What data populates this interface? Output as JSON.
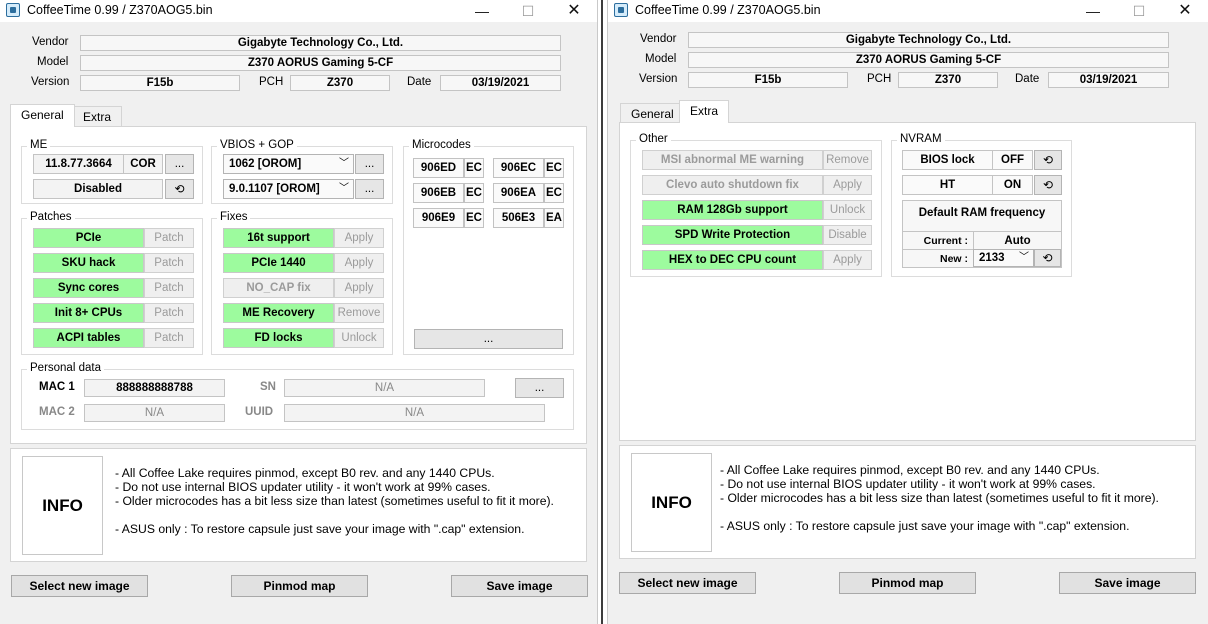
{
  "left": {
    "title": "CoffeeTime 0.99  /  Z370AOG5.bin",
    "vendor_label": "Vendor",
    "vendor": "Gigabyte Technology Co., Ltd.",
    "model_label": "Model",
    "model": "Z370 AORUS Gaming 5-CF",
    "version_label": "Version",
    "version": "F15b",
    "pch_label": "PCH",
    "pch": "Z370",
    "date_label": "Date",
    "date": "03/19/2021",
    "tabs": [
      "General",
      "Extra"
    ],
    "me": {
      "title": "ME",
      "version": "11.8.77.3664",
      "type": "COR",
      "more": "...",
      "status": "Disabled",
      "refresh_icon": "refresh-icon"
    },
    "vbios": {
      "title": "VBIOS + GOP",
      "vbios_value": "1062 [OROM]",
      "gop_value": "9.0.1107 [OROM]",
      "more": "..."
    },
    "microcodes": {
      "title": "Microcodes",
      "items": [
        {
          "id": "906ED",
          "tag": "EC"
        },
        {
          "id": "906EC",
          "tag": "EC"
        },
        {
          "id": "906EB",
          "tag": "EC"
        },
        {
          "id": "906EA",
          "tag": "EC"
        },
        {
          "id": "906E9",
          "tag": "EC"
        },
        {
          "id": "506E3",
          "tag": "EA"
        }
      ],
      "more": "..."
    },
    "patches": {
      "title": "Patches",
      "items": [
        {
          "label": "PCIe",
          "action": "Patch"
        },
        {
          "label": "SKU hack",
          "action": "Patch"
        },
        {
          "label": "Sync cores",
          "action": "Patch"
        },
        {
          "label": "Init 8+ CPUs",
          "action": "Patch"
        },
        {
          "label": "ACPI tables",
          "action": "Patch"
        }
      ]
    },
    "fixes": {
      "title": "Fixes",
      "items": [
        {
          "label": "16t support",
          "action": "Apply"
        },
        {
          "label": "PCIe 1440",
          "action": "Apply"
        },
        {
          "label": "NO_CAP fix",
          "action": "Apply"
        },
        {
          "label": "ME Recovery",
          "action": "Remove"
        },
        {
          "label": "FD locks",
          "action": "Unlock"
        }
      ]
    },
    "personal": {
      "title": "Personal data",
      "mac1_label": "MAC 1",
      "mac1": "888888888788",
      "mac2_label": "MAC 2",
      "mac2": "N/A",
      "sn_label": "SN",
      "sn": "N/A",
      "uuid_label": "UUID",
      "uuid": "N/A",
      "more": "..."
    }
  },
  "right": {
    "title": "CoffeeTime 0.99  /  Z370AOG5.bin",
    "vendor_label": "Vendor",
    "vendor": "Gigabyte Technology Co., Ltd.",
    "model_label": "Model",
    "model": "Z370 AORUS Gaming 5-CF",
    "version_label": "Version",
    "version": "F15b",
    "pch_label": "PCH",
    "pch": "Z370",
    "date_label": "Date",
    "date": "03/19/2021",
    "tabs": [
      "General",
      "Extra"
    ],
    "other": {
      "title": "Other",
      "items": [
        {
          "label": "MSI abnormal ME warning",
          "action": "Remove"
        },
        {
          "label": "Clevo auto shutdown fix",
          "action": "Apply"
        },
        {
          "label": "RAM 128Gb support",
          "action": "Unlock"
        },
        {
          "label": "SPD Write Protection",
          "action": "Disable"
        },
        {
          "label": "HEX to DEC CPU count",
          "action": "Apply"
        }
      ]
    },
    "nvram": {
      "title": "NVRAM",
      "bios_lock_label": "BIOS lock",
      "bios_lock_value": "OFF",
      "ht_label": "HT",
      "ht_value": "ON",
      "ram_freq_title": "Default RAM frequency",
      "current_label": "Current :",
      "current_value": "Auto",
      "new_label": "New :",
      "new_value": "2133"
    }
  },
  "info": {
    "box_label": "INFO",
    "lines": [
      "- All Coffee Lake requires pinmod, except B0 rev. and any 1440 CPUs.",
      "- Do not use internal BIOS updater utility - it won't work at 99% cases.",
      "- Older microcodes has a bit less size than latest (sometimes useful to fit it more).",
      "- ASUS only : To restore capsule just save your image with \".cap\" extension."
    ]
  },
  "buttons": {
    "select_image": "Select new image",
    "pinmod_map": "Pinmod map",
    "save_image": "Save image"
  },
  "window_controls": {
    "minimize": "—",
    "maximize": "☐",
    "close": "✕"
  }
}
